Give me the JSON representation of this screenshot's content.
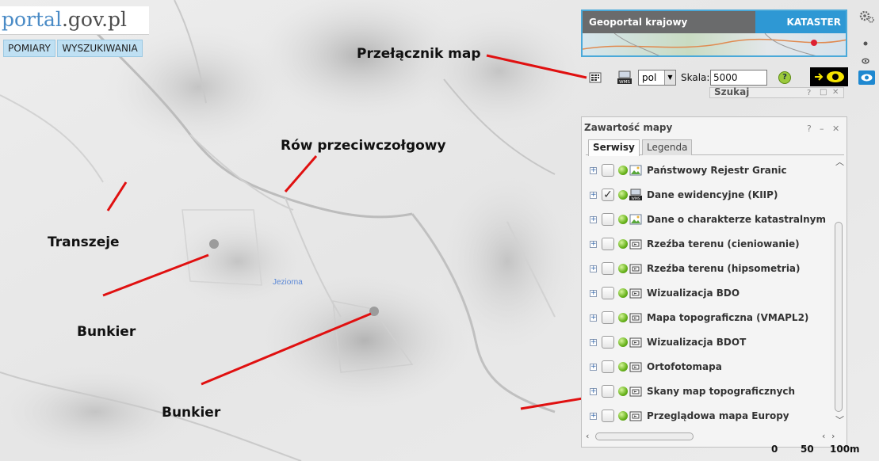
{
  "logo": {
    "part_a": "portal",
    "part_b": ".gov.pl"
  },
  "top_buttons": {
    "pomiary": "POMIARY",
    "wyszukiwania": "WYSZUKIWANIA"
  },
  "map": {
    "label": "Jeziorna"
  },
  "annotations": {
    "przelacznik": "Przełącznik map",
    "row": "Rów przeciwczołgowy",
    "transzeje": "Transzeje",
    "bunkier_1": "Bunkier",
    "bunkier_2": "Bunkier",
    "line_color": "#e01010"
  },
  "banner": {
    "left": "Geoportal krajowy",
    "right": "KATASTER"
  },
  "toolbar": {
    "lang": "pol",
    "scale_label": "Skala:",
    "scale_value": "5000",
    "help": "?",
    "wms_label": "WMS"
  },
  "szukaj": {
    "title": "Szukaj"
  },
  "panel": {
    "title": "Zawartość mapy",
    "help": "?",
    "minimize": "–",
    "close": "✕",
    "tabs": [
      "Serwisy",
      "Legenda"
    ],
    "layers": [
      {
        "label": "Państwowy Rejestr Granic",
        "checked": false,
        "icon": "image-layer-icon"
      },
      {
        "label": "Dane ewidencyjne (KIIP)",
        "checked": true,
        "icon": "wms-icon"
      },
      {
        "label": "Dane o charakterze katastralnym",
        "checked": false,
        "icon": "image-layer-icon"
      },
      {
        "label": "Rzeźba terenu (cieniowanie)",
        "checked": false,
        "icon": "camera-icon"
      },
      {
        "label": "Rzeźba terenu (hipsometria)",
        "checked": false,
        "icon": "camera-icon"
      },
      {
        "label": "Wizualizacja BDO",
        "checked": false,
        "icon": "camera-icon"
      },
      {
        "label": "Mapa topograficzna (VMAPL2)",
        "checked": false,
        "icon": "camera-icon"
      },
      {
        "label": "Wizualizacja BDOT",
        "checked": false,
        "icon": "camera-icon"
      },
      {
        "label": "Ortofotomapa",
        "checked": false,
        "icon": "camera-icon"
      },
      {
        "label": "Skany map topograficznych",
        "checked": false,
        "icon": "camera-icon"
      },
      {
        "label": "Przeglądowa mapa Europy",
        "checked": false,
        "icon": "camera-icon"
      }
    ]
  },
  "scale_bar": {
    "t0": "0",
    "t1": "50",
    "t2": "100m"
  }
}
